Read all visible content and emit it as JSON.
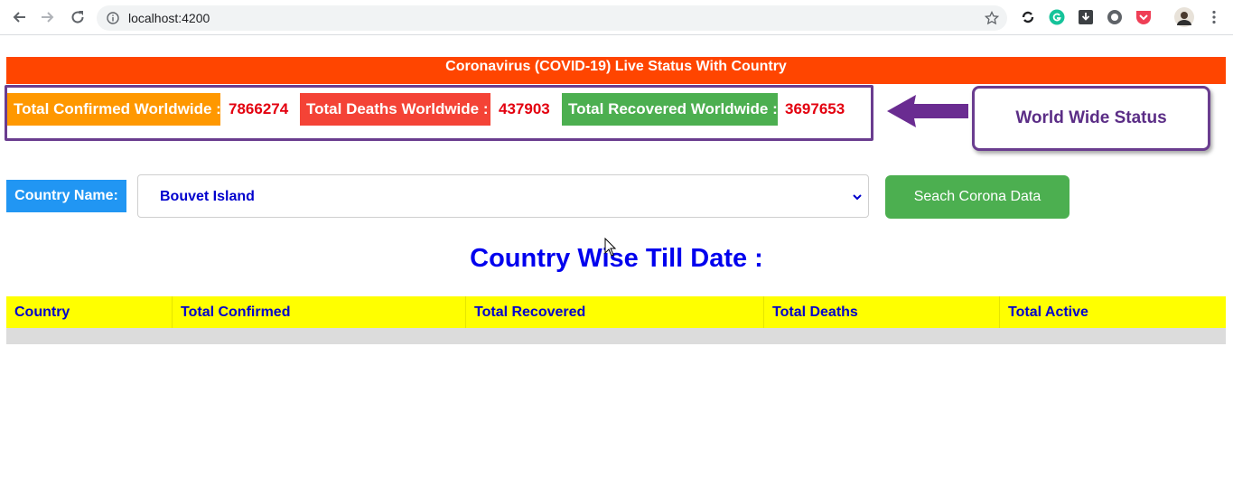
{
  "browser": {
    "url": "localhost:4200"
  },
  "page": {
    "banner_title": "Coronavirus (COVID-19) Live Status With Country",
    "worldwide": {
      "confirmed_label": "Total Confirmed Worldwide :",
      "confirmed_value": "7866274",
      "deaths_label": "Total Deaths Worldwide :",
      "deaths_value": "437903",
      "recovered_label": "Total Recovered Worldwide :",
      "recovered_value": "3697653"
    },
    "callout_text": "World Wide Status",
    "country_label": "Country Name:",
    "country_selected": "Bouvet Island",
    "search_button": "Seach Corona Data",
    "section_title": "Country Wise Till Date :",
    "table_headers": [
      "Country",
      "Total Confirmed",
      "Total Recovered",
      "Total Deaths",
      "Total Active"
    ]
  },
  "colors": {
    "banner": "#ff4500",
    "confirmed": "#ff9800",
    "deaths": "#f44336",
    "recovered": "#4caf50",
    "country_label": "#2196f3",
    "table_header": "#ffff00",
    "highlight_border": "#6a3d8f"
  },
  "icons": [
    "back-arrow-icon",
    "forward-arrow-icon",
    "reload-icon",
    "info-icon",
    "star-icon",
    "chevron-down-icon",
    "annotation-arrow-icon"
  ]
}
